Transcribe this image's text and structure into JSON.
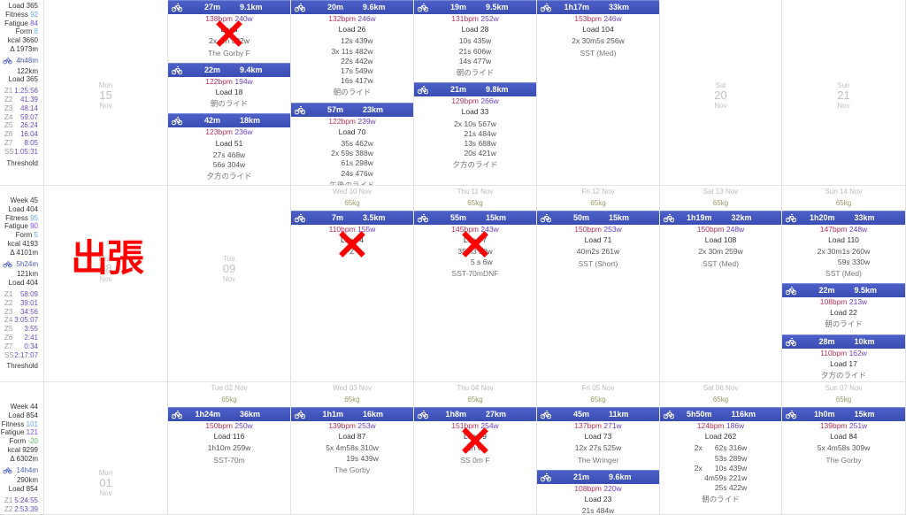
{
  "colors": {
    "header": "#4356bc",
    "bpm": "#b5305e",
    "watts": "#6d3fc0",
    "fitness": "#64a8e8",
    "fatigue": "#7c4dff",
    "form_positive": "#64a8e8",
    "form_negative": "#5cc85c",
    "annotation": "#ff0000"
  },
  "annotation_text": "出張",
  "weeks": [
    {
      "summary": {
        "week": "",
        "load": "Load 365",
        "fitness_label": "Fitness",
        "fitness": "92",
        "fatigue_label": "Fatigue",
        "fatigue": "84",
        "form_label": "Form",
        "form": "8",
        "kcal": "kcal 3660",
        "elev": "Δ 1973m",
        "ride_time": "4h48m",
        "ride_dist": "122km",
        "ride_load": "Load 365",
        "zones": [
          [
            "Z1",
            "1:25:56"
          ],
          [
            "Z2",
            "41:39"
          ],
          [
            "Z3",
            "48:14"
          ],
          [
            "Z4",
            "59:07"
          ],
          [
            "Z5",
            "26:24"
          ],
          [
            "Z6",
            "16:04"
          ],
          [
            "Z7",
            "8:05"
          ],
          [
            "SS",
            "1:05:31"
          ]
        ],
        "threshold": "Threshold"
      },
      "days": [
        {
          "empty": [
            "Mon",
            "15",
            "Nov"
          ]
        },
        {
          "activities": [
            {
              "duration": "27m",
              "distance": "9.1km",
              "bpm": "138bpm",
              "watts": "240w",
              "load": "Load",
              "intervals": [
                "2x 4m 302w"
              ],
              "name": "The Gorby F",
              "crossed": true
            },
            {
              "duration": "22m",
              "distance": "9.4km",
              "bpm": "122bpm",
              "watts": "194w",
              "load": "Load 18",
              "intervals": [],
              "name": "朝のライド"
            },
            {
              "duration": "42m",
              "distance": "18km",
              "bpm": "123bpm",
              "watts": "236w",
              "load": "Load 51",
              "intervals": [
                "27s 468w",
                "56s 304w"
              ],
              "name": "夕方のライド"
            }
          ]
        },
        {
          "activities": [
            {
              "duration": "20m",
              "distance": "9.6km",
              "bpm": "132bpm",
              "watts": "246w",
              "load": "Load 26",
              "intervals": [
                "12s 439w",
                "3x 11s 482w",
                "22s 442w",
                "17s 549w",
                "16s 417w"
              ],
              "name": "朝のライド"
            },
            {
              "duration": "57m",
              "distance": "23km",
              "bpm": "122bpm",
              "watts": "239w",
              "load": "Load 70",
              "intervals": [
                "35s 462w",
                "2x 59s 388w",
                "61s 298w",
                "24s 476w"
              ],
              "name": "午後のライド"
            }
          ]
        },
        {
          "activities": [
            {
              "duration": "19m",
              "distance": "9.5km",
              "bpm": "131bpm",
              "watts": "252w",
              "load": "Load 28",
              "intervals": [
                "10s 435w",
                "21s 606w",
                "14s 477w"
              ],
              "name": "朝のライド"
            },
            {
              "duration": "21m",
              "distance": "9.8km",
              "bpm": "129bpm",
              "watts": "266w",
              "load": "Load 33",
              "intervals": [
                "2x 10s 567w",
                "21s 484w",
                "13s 688w",
                "20s 421w"
              ],
              "name": "夕方のライド"
            }
          ]
        },
        {
          "activities": [
            {
              "duration": "1h17m",
              "distance": "33km",
              "bpm": "153bpm",
              "watts": "246w",
              "load": "Load 104",
              "intervals": [
                "2x 30m5s 256w"
              ],
              "name": "SST (Med)"
            }
          ]
        },
        {
          "empty": [
            "Sat",
            "20",
            "Nov"
          ]
        },
        {
          "empty": [
            "Sun",
            "21",
            "Nov"
          ]
        }
      ]
    },
    {
      "summary": {
        "week": "Week 45",
        "load": "Load 404",
        "fitness_label": "Fitness",
        "fitness": "95",
        "fatigue_label": "Fatigue",
        "fatigue": "90",
        "form_label": "Form",
        "form": "5",
        "kcal": "kcal 4193",
        "elev": "Δ 4101m",
        "ride_time": "5h24m",
        "ride_dist": "121km",
        "ride_load": "Load 404",
        "zones": [
          [
            "Z1",
            "58:09"
          ],
          [
            "Z2",
            "39:01"
          ],
          [
            "Z3",
            "34:56"
          ],
          [
            "Z4",
            "3:05:07"
          ],
          [
            "Z5",
            "3:55"
          ],
          [
            "Z6",
            "2:41"
          ],
          [
            "Z7",
            "0:34"
          ],
          [
            "SS",
            "2:17:07"
          ]
        ],
        "threshold": "Threshold"
      },
      "days": [
        {
          "empty": [
            "Mon",
            "08",
            "Nov"
          ]
        },
        {
          "empty": [
            "Tue",
            "09",
            "Nov"
          ]
        },
        {
          "date": "Wed 10 Nov",
          "weight": "65kg",
          "activities": [
            {
              "duration": "7m",
              "distance": "3.5km",
              "bpm": "110bpm",
              "watts": "155w",
              "load": "Load 4",
              "intervals": [
                "Z"
              ],
              "name": "",
              "crossed": true
            }
          ]
        },
        {
          "date": "Thu 11 Nov",
          "weight": "65kg",
          "activities": [
            {
              "duration": "55m",
              "distance": "15km",
              "bpm": "145bpm",
              "watts": "243w",
              "load": "Load 7",
              "intervals": [
                "35m3 58w",
                "5 s 6w"
              ],
              "name": "SST-70mDNF",
              "crossed": true
            }
          ]
        },
        {
          "date": "Fri 12 Nov",
          "weight": "65kg",
          "activities": [
            {
              "duration": "50m",
              "distance": "15km",
              "bpm": "150bpm",
              "watts": "253w",
              "load": "Load 71",
              "intervals": [
                "40m2s 261w"
              ],
              "name": "SST (Short)"
            }
          ]
        },
        {
          "date": "Sat 13 Nov",
          "weight": "65kg",
          "activities": [
            {
              "duration": "1h19m",
              "distance": "32km",
              "bpm": "150bpm",
              "watts": "248w",
              "load": "Load 108",
              "intervals": [
                "2x 30m 259w"
              ],
              "name": "SST (Med)"
            }
          ]
        },
        {
          "date": "Sun 14 Nov",
          "weight": "65kg",
          "activities": [
            {
              "duration": "1h20m",
              "distance": "33km",
              "bpm": "147bpm",
              "watts": "248w",
              "load": "Load 110",
              "intervals": [
                "2x 30m1s 260w",
                "59s 330w"
              ],
              "name": "SST (Med)"
            },
            {
              "duration": "22m",
              "distance": "9.5km",
              "bpm": "108bpm",
              "watts": "213w",
              "load": "Load 22",
              "intervals": [],
              "name": "朝のライド"
            },
            {
              "duration": "28m",
              "distance": "10km",
              "bpm": "110bpm",
              "watts": "162w",
              "load": "Load 17",
              "intervals": [],
              "name": "夕方のライド"
            }
          ]
        }
      ]
    },
    {
      "summary": {
        "week": "Week 44",
        "load": "Load 854",
        "fitness_label": "Fitness",
        "fitness": "101",
        "fatigue_label": "Fatigue",
        "fatigue": "121",
        "form_label": "Form",
        "form": "-20",
        "kcal": "kcal 9299",
        "elev": "Δ 6302m",
        "ride_time": "14h4m",
        "ride_dist": "290km",
        "ride_load": "Load 854",
        "zones": [
          [
            "Z1",
            "5:24:55"
          ],
          [
            "Z2",
            "2:53:39"
          ]
        ],
        "threshold": ""
      },
      "days": [
        {
          "empty": [
            "Mon",
            "01",
            "Nov"
          ]
        },
        {
          "date": "Tue 02 Nov",
          "weight": "65kg",
          "activities": [
            {
              "duration": "1h24m",
              "distance": "36km",
              "bpm": "150bpm",
              "watts": "250w",
              "load": "Load 116",
              "intervals": [
                "1h10m 259w"
              ],
              "name": "SST-70m"
            }
          ]
        },
        {
          "date": "Wed 03 Nov",
          "weight": "65kg",
          "activities": [
            {
              "duration": "1h1m",
              "distance": "16km",
              "bpm": "139bpm",
              "watts": "253w",
              "load": "Load 87",
              "intervals": [
                "5x 4m58s 310w",
                "19s 439w"
              ],
              "name": "The Gorby"
            }
          ]
        },
        {
          "date": "Thu 04 Nov",
          "weight": "65kg",
          "activities": [
            {
              "duration": "1h8m",
              "distance": "27km",
              "bpm": "151bpm",
              "watts": "254w",
              "load": "Load 9",
              "intervals": [
                "1h w"
              ],
              "name": "SS 0m F",
              "crossed": true
            }
          ]
        },
        {
          "date": "Fri 05 Nov",
          "weight": "65kg",
          "activities": [
            {
              "duration": "45m",
              "distance": "11km",
              "bpm": "137bpm",
              "watts": "271w",
              "load": "Load 73",
              "intervals": [
                "12x 27s 525w"
              ],
              "name": "The Wringer"
            },
            {
              "duration": "21m",
              "distance": "9.6km",
              "bpm": "108bpm",
              "watts": "220w",
              "load": "Load 23",
              "intervals": [
                "21s 484w"
              ],
              "name": ""
            }
          ]
        },
        {
          "date": "Sat 06 Nov",
          "weight": "65kg",
          "activities": [
            {
              "duration": "5h50m",
              "distance": "116km",
              "bpm": "124bpm",
              "watts": "186w",
              "load": "Load 262",
              "intervals": [
                "2x      62s 316w",
                "53s 289w",
                "2x      10s 439w",
                "4m59s 221w",
                "25s 422w"
              ],
              "name": "朝のライド"
            }
          ]
        },
        {
          "date": "Sun 07 Nov",
          "weight": "65kg",
          "activities": [
            {
              "duration": "1h0m",
              "distance": "15km",
              "bpm": "139bpm",
              "watts": "251w",
              "load": "Load 84",
              "intervals": [
                "5x 4m58s 309w"
              ],
              "name": "The Gorby"
            }
          ]
        }
      ]
    }
  ]
}
